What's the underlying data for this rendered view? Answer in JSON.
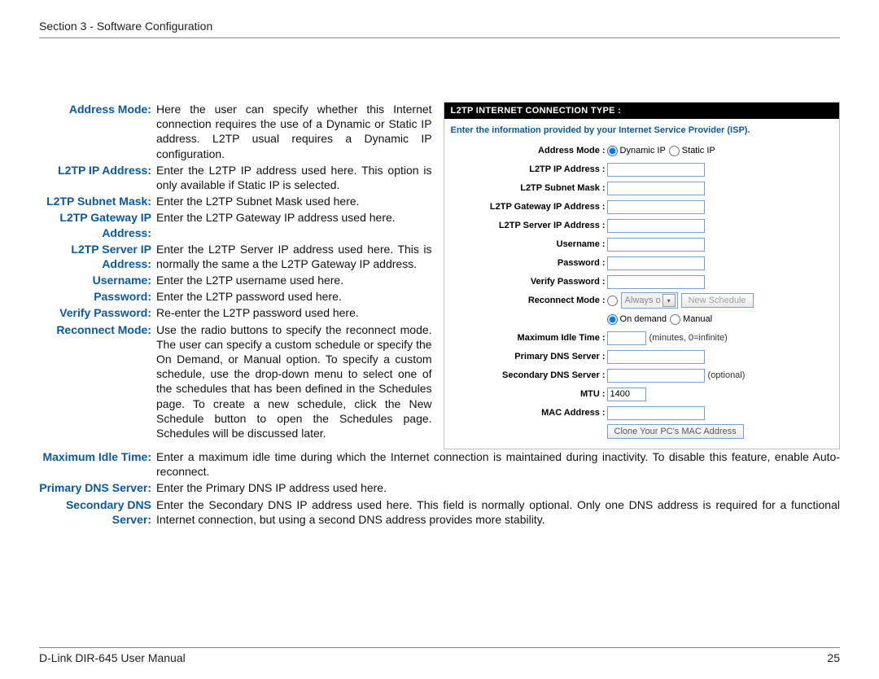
{
  "header": {
    "section": "Section 3 - Software Configuration"
  },
  "definitions": [
    {
      "label": "Address Mode:",
      "desc": "Here the user can specify whether this Internet connection requires the use of a Dynamic or Static IP address. L2TP usual requires a Dynamic IP configuration."
    },
    {
      "label": "L2TP IP Address:",
      "desc": "Enter the L2TP IP address used here. This option is only available if Static IP is selected."
    },
    {
      "label": "L2TP Subnet Mask:",
      "desc": "Enter the L2TP Subnet Mask used here."
    },
    {
      "label": "L2TP Gateway IP Address:",
      "desc": "Enter the L2TP Gateway IP address used here."
    },
    {
      "label": "L2TP Server IP Address:",
      "desc": "Enter the L2TP Server IP address used here. This is normally the same a the L2TP Gateway IP address."
    },
    {
      "label": "Username:",
      "desc": "Enter the L2TP username used here."
    },
    {
      "label": "Password:",
      "desc": "Enter the L2TP password used here."
    },
    {
      "label": "Verify Password:",
      "desc": "Re-enter the L2TP password used here."
    },
    {
      "label": "Reconnect Mode:",
      "desc": "Use the radio buttons to specify the reconnect mode. The user can specify a custom schedule or specify the On Demand, or Manual option. To specify a custom schedule, use the drop-down menu to select one of the schedules that has been defined in the Schedules page. To create a new schedule, click the New Schedule button to open the Schedules page. Schedules will be discussed later."
    }
  ],
  "definitions_wide": [
    {
      "label": "Maximum Idle Time:",
      "desc": "Enter a maximum idle time during which the Internet connection is maintained during inactivity. To disable this feature, enable Auto-reconnect."
    },
    {
      "label": "Primary DNS Server:",
      "desc": "Enter the Primary DNS IP address used here."
    },
    {
      "label": "Secondary DNS Server:",
      "desc": "Enter the Secondary DNS IP address used here. This field is normally optional. Only one DNS address is required for a functional Internet connection, but using a second DNS address provides more stability."
    }
  ],
  "panel": {
    "title": "L2TP INTERNET CONNECTION TYPE :",
    "info": "Enter the information provided by your Internet Service Provider (ISP).",
    "addressMode": {
      "label": "Address Mode :",
      "dynamic": "Dynamic IP",
      "static": "Static IP",
      "selected": "dynamic"
    },
    "ip": {
      "label": "L2TP IP Address :",
      "value": ""
    },
    "subnet": {
      "label": "L2TP Subnet Mask :",
      "value": ""
    },
    "gateway": {
      "label": "L2TP Gateway IP Address :",
      "value": ""
    },
    "serverip": {
      "label": "L2TP Server IP Address :",
      "value": ""
    },
    "username": {
      "label": "Username :",
      "value": ""
    },
    "password": {
      "label": "Password :",
      "value": ""
    },
    "verify": {
      "label": "Verify Password :",
      "value": ""
    },
    "reconnect": {
      "label": "Reconnect Mode :",
      "dropdown": "Always o",
      "newSchedule": "New Schedule",
      "ondemand": "On demand",
      "manual": "Manual",
      "selected": "ondemand"
    },
    "idle": {
      "label": "Maximum Idle Time :",
      "value": "",
      "hint": "(minutes, 0=infinite)"
    },
    "dns1": {
      "label": "Primary DNS Server :",
      "value": ""
    },
    "dns2": {
      "label": "Secondary DNS Server :",
      "value": "",
      "hint": "(optional)"
    },
    "mtu": {
      "label": "MTU :",
      "value": "1400"
    },
    "mac": {
      "label": "MAC Address :",
      "value": "",
      "clone": "Clone Your PC's MAC Address"
    }
  },
  "footer": {
    "left": "D-Link DIR-645 User Manual",
    "right": "25"
  }
}
